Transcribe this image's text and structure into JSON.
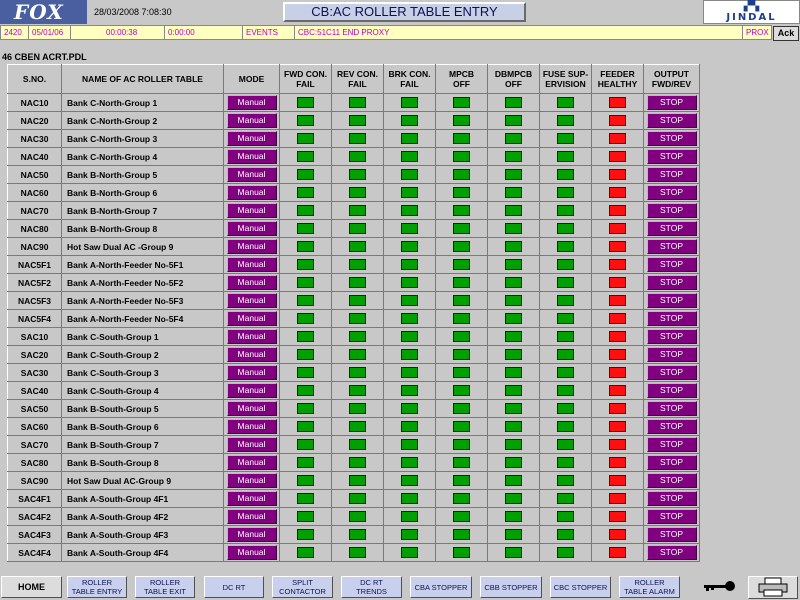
{
  "header": {
    "logo": "FOX",
    "datetime": "28/03/2008 7:08:30",
    "title": "CB:AC ROLLER TABLE ENTRY",
    "brand": "JINDAL"
  },
  "alarm": {
    "id": "2420",
    "date": "05/01/06",
    "time1": "00:00:38",
    "time2": "0:00:00",
    "type": "EVENTS",
    "message": "CBC:51C11 END PROXY",
    "tail": "PROX",
    "ack_label": "Ack"
  },
  "subtitle": "46  CBEN  ACRT.PDL",
  "table": {
    "headers": {
      "sno": "S.NO.",
      "name": "NAME OF AC ROLLER TABLE",
      "mode": "MODE",
      "fwd_l1": "FWD CON.",
      "fwd_l2": "FAIL",
      "rev_l1": "REV CON.",
      "rev_l2": "FAIL",
      "brk_l1": "BRK CON.",
      "brk_l2": "FAIL",
      "mpcb_l1": "MPCB",
      "mpcb_l2": "OFF",
      "dbmpcb_l1": "DBMPCB",
      "dbmpcb_l2": "OFF",
      "fuse_l1": "FUSE SUP-",
      "fuse_l2": "ERVISION",
      "feeder_l1": "FEEDER",
      "feeder_l2": "HEALTHY",
      "output_l1": "OUTPUT",
      "output_l2": "FWD/REV"
    },
    "mode_label": "Manual",
    "output_label": "STOP",
    "status_colors": {
      "ok": "#00a000",
      "fault": "#ff1010"
    },
    "rows": [
      {
        "sno": "NAC10",
        "name": "Bank C-North-Group 1"
      },
      {
        "sno": "NAC20",
        "name": "Bank C-North-Group 2"
      },
      {
        "sno": "NAC30",
        "name": "Bank C-North-Group 3"
      },
      {
        "sno": "NAC40",
        "name": "Bank C-North-Group 4"
      },
      {
        "sno": "NAC50",
        "name": "Bank B-North-Group 5"
      },
      {
        "sno": "NAC60",
        "name": "Bank B-North-Group 6"
      },
      {
        "sno": "NAC70",
        "name": "Bank B-North-Group 7"
      },
      {
        "sno": "NAC80",
        "name": "Bank B-North-Group 8"
      },
      {
        "sno": "NAC90",
        "name": "Hot Saw Dual AC -Group 9"
      },
      {
        "sno": "NAC5F1",
        "name": "Bank A-North-Feeder No-5F1"
      },
      {
        "sno": "NAC5F2",
        "name": "Bank A-North-Feeder No-5F2"
      },
      {
        "sno": "NAC5F3",
        "name": "Bank A-North-Feeder No-5F3"
      },
      {
        "sno": "NAC5F4",
        "name": "Bank A-North-Feeder No-5F4"
      },
      {
        "sno": "SAC10",
        "name": "Bank C-South-Group 1"
      },
      {
        "sno": "SAC20",
        "name": "Bank C-South-Group 2"
      },
      {
        "sno": "SAC30",
        "name": "Bank C-South-Group 3"
      },
      {
        "sno": "SAC40",
        "name": "Bank C-South-Group 4"
      },
      {
        "sno": "SAC50",
        "name": "Bank B-South-Group 5"
      },
      {
        "sno": "SAC60",
        "name": "Bank B-South-Group 6"
      },
      {
        "sno": "SAC70",
        "name": "Bank B-South-Group 7"
      },
      {
        "sno": "SAC80",
        "name": "Bank B-South-Group 8"
      },
      {
        "sno": "SAC90",
        "name": "Hot Saw Dual AC-Group 9"
      },
      {
        "sno": "SAC4F1",
        "name": "Bank A-South-Group 4F1"
      },
      {
        "sno": "SAC4F2",
        "name": "Bank A-South-Group 4F2"
      },
      {
        "sno": "SAC4F3",
        "name": "Bank A-South-Group 4F3"
      },
      {
        "sno": "SAC4F4",
        "name": "Bank A-South-Group 4F4"
      }
    ]
  },
  "footer": {
    "home": "HOME",
    "roller_entry_l1": "ROLLER",
    "roller_entry_l2": "TABLE ENTRY",
    "roller_exit_l1": "ROLLER",
    "roller_exit_l2": "TABLE EXIT",
    "dc_rt": "DC RT",
    "split_l1": "SPLIT",
    "split_l2": "CONTACTOR",
    "dc_trends_l1": "DC RT",
    "dc_trends_l2": "TRENDS",
    "cba": "CBA STOPPER",
    "cbb": "CBB STOPPER",
    "cbc": "CBC STOPPER",
    "alarm_l1": "ROLLER",
    "alarm_l2": "TABLE ALARM",
    "key_icon": "key-icon",
    "printer_icon": "printer-icon"
  }
}
